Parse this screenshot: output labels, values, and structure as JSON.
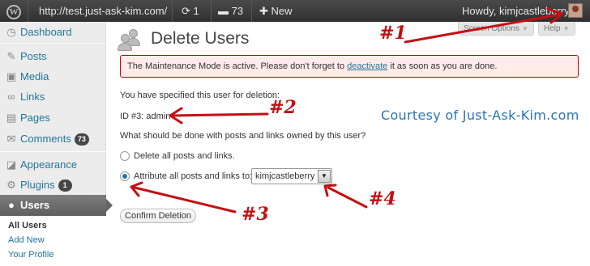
{
  "admin_bar": {
    "site_url": "http://test.just-ask-kim.com/",
    "updates_count": "1",
    "comments_count": "73",
    "new_label": "New",
    "howdy": "Howdy, kimjcastleberry"
  },
  "sidebar": {
    "items": [
      {
        "label": "Dashboard",
        "icon": "dashboard-icon"
      },
      {
        "label": "Posts",
        "icon": "pin-icon"
      },
      {
        "label": "Media",
        "icon": "media-icon"
      },
      {
        "label": "Links",
        "icon": "link-icon"
      },
      {
        "label": "Pages",
        "icon": "page-icon"
      },
      {
        "label": "Comments",
        "icon": "comment-icon",
        "badge": "73"
      },
      {
        "label": "Appearance",
        "icon": "appearance-icon"
      },
      {
        "label": "Plugins",
        "icon": "plugin-icon",
        "badge": "1"
      },
      {
        "label": "Users",
        "icon": "users-icon"
      }
    ],
    "submenu": [
      "All Users",
      "Add New",
      "Your Profile"
    ]
  },
  "page": {
    "title": "Delete Users",
    "screen_options": "Screen Options",
    "help": "Help"
  },
  "notice": {
    "before": "The Maintenance Mode is active. Please don't forget to ",
    "link": "deactivate",
    "after": " it as soon as you are done."
  },
  "form": {
    "specified": "You have specified this user for deletion:",
    "user_id": "ID #3: admin",
    "question": "What should be done with posts and links owned by this user?",
    "option_delete": "Delete all posts and links.",
    "option_attribute": "Attribute all posts and links to:",
    "attribute_selected": "kimjcastleberry",
    "confirm_button": "Confirm Deletion"
  },
  "annotations": {
    "courtesy": "Courtesy of Just-Ask-Kim.com",
    "marks": [
      "#1",
      "#2",
      "#3",
      "#4"
    ],
    "color": "#c40f14"
  },
  "colors": {
    "link": "#21759b",
    "admin_bar": "#3a3a3a",
    "notice_bg": "#ffebe8",
    "notice_border": "#cc0000",
    "courtesy": "#2b73b8"
  }
}
